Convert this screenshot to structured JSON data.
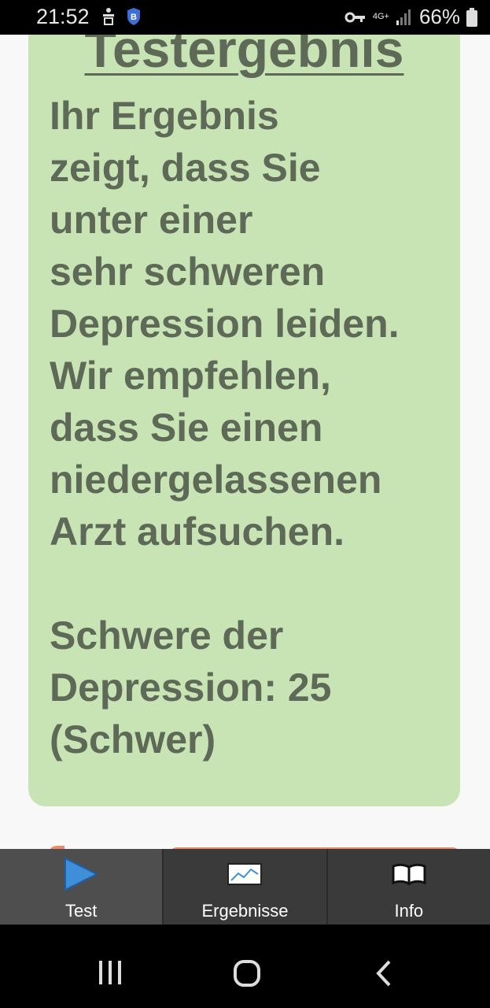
{
  "status": {
    "time": "21:52",
    "network": "4G+",
    "battery": "66%"
  },
  "result": {
    "title": "Testergebnis",
    "lines": [
      "Ihr Ergebnis",
      "zeigt, dass Sie",
      "unter einer",
      "sehr schweren",
      "Depression leiden.",
      "Wir empfehlen,",
      "dass Sie einen",
      "niedergelassenen",
      "Arzt aufsuchen."
    ],
    "severity_lines": [
      "Schwere der",
      "Depression: 25",
      "(Schwer)"
    ]
  },
  "tabs": [
    {
      "label": "Test",
      "icon": "play-icon",
      "active": true
    },
    {
      "label": "Ergebnisse",
      "icon": "chart-icon",
      "active": false
    },
    {
      "label": "Info",
      "icon": "book-icon",
      "active": false
    }
  ],
  "colors": {
    "card": "#c8e4b5",
    "text": "#5e6a57",
    "accent": "#3d8fd8"
  }
}
